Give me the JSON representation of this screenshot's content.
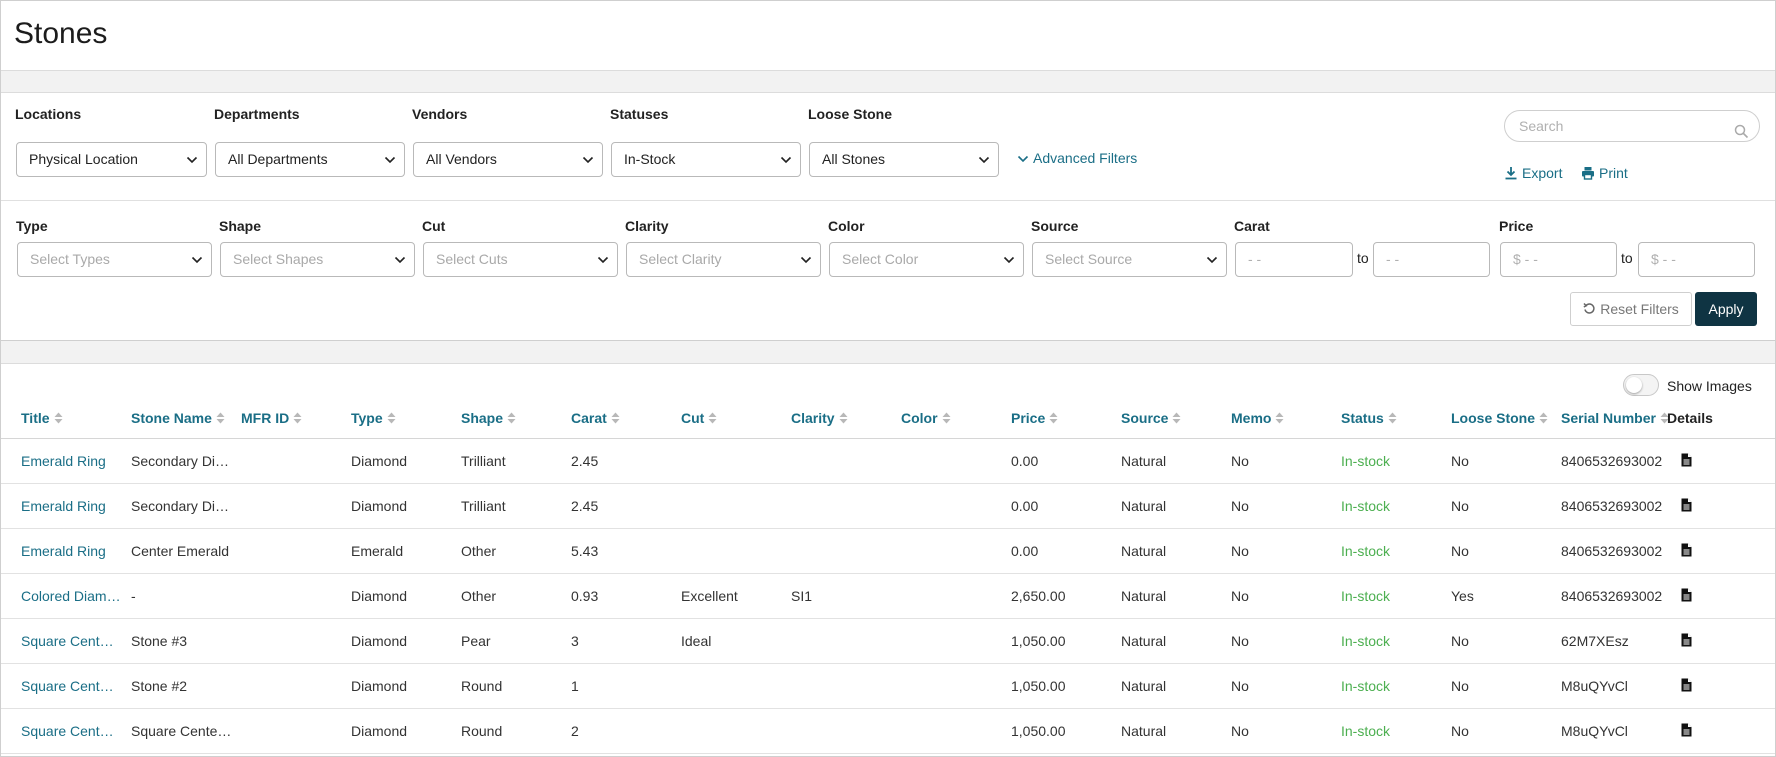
{
  "page": {
    "title": "Stones"
  },
  "filters": {
    "row1": [
      {
        "label": "Locations",
        "value": "Physical Location"
      },
      {
        "label": "Departments",
        "value": "All Departments"
      },
      {
        "label": "Vendors",
        "value": "All Vendors"
      },
      {
        "label": "Statuses",
        "value": "In-Stock"
      },
      {
        "label": "Loose Stone",
        "value": "All Stones"
      }
    ],
    "advanced_label": "Advanced Filters",
    "search_placeholder": "Search",
    "export_label": "Export",
    "print_label": "Print",
    "row2": [
      {
        "label": "Type",
        "placeholder": "Select Types"
      },
      {
        "label": "Shape",
        "placeholder": "Select Shapes"
      },
      {
        "label": "Cut",
        "placeholder": "Select Cuts"
      },
      {
        "label": "Clarity",
        "placeholder": "Select Clarity"
      },
      {
        "label": "Color",
        "placeholder": "Select Color"
      },
      {
        "label": "Source",
        "placeholder": "Select Source"
      }
    ],
    "carat": {
      "label": "Carat",
      "from_placeholder": "- -",
      "to_label": "to",
      "to_placeholder": "- -"
    },
    "price": {
      "label": "Price",
      "from_placeholder": "$ - -",
      "to_label": "to",
      "to_placeholder": "$ - -"
    },
    "reset_label": "Reset Filters",
    "apply_label": "Apply"
  },
  "table": {
    "show_images_label": "Show Images",
    "columns": [
      "Title",
      "Stone Name",
      "MFR ID",
      "Type",
      "Shape",
      "Carat",
      "Cut",
      "Clarity",
      "Color",
      "Price",
      "Source",
      "Memo",
      "Status",
      "Loose Stone",
      "Serial Number",
      "Details"
    ],
    "rows": [
      [
        "Emerald Ring",
        "Secondary Diamond",
        "",
        "Diamond",
        "Trilliant",
        "2.45",
        "",
        "",
        "",
        "0.00",
        "Natural",
        "No",
        "In-stock",
        "No",
        "8406532693002"
      ],
      [
        "Emerald Ring",
        "Secondary Diamond",
        "",
        "Diamond",
        "Trilliant",
        "2.45",
        "",
        "",
        "",
        "0.00",
        "Natural",
        "No",
        "In-stock",
        "No",
        "8406532693002"
      ],
      [
        "Emerald Ring",
        "Center Emerald",
        "",
        "Emerald",
        "Other",
        "5.43",
        "",
        "",
        "",
        "0.00",
        "Natural",
        "No",
        "In-stock",
        "No",
        "8406532693002"
      ],
      [
        "Colored Diamond Ring",
        "-",
        "",
        "Diamond",
        "Other",
        "0.93",
        "Excellent",
        "SI1",
        "",
        "2,650.00",
        "Natural",
        "No",
        "In-stock",
        "Yes",
        "8406532693002"
      ],
      [
        "Square Center Ring",
        "Stone #3",
        "",
        "Diamond",
        "Pear",
        "3",
        "Ideal",
        "",
        "",
        "1,050.00",
        "Natural",
        "No",
        "In-stock",
        "No",
        "62M7XEsz"
      ],
      [
        "Square Center Ring",
        "Stone #2",
        "",
        "Diamond",
        "Round",
        "1",
        "",
        "",
        "",
        "1,050.00",
        "Natural",
        "No",
        "In-stock",
        "No",
        "M8uQYvCl"
      ],
      [
        "Square Center Ring",
        "Square Center Stone",
        "",
        "Diamond",
        "Round",
        "2",
        "",
        "",
        "",
        "1,050.00",
        "Natural",
        "No",
        "In-stock",
        "No",
        "M8uQYvCl"
      ]
    ]
  },
  "colors": {
    "accent": "#1a6e86",
    "apply": "#0f3443",
    "status_in_stock": "#4caf50"
  }
}
